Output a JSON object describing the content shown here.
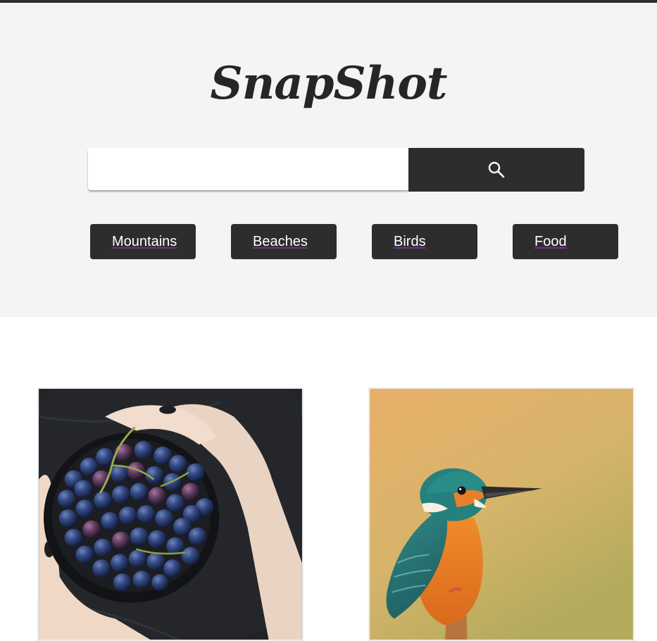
{
  "app": {
    "logo": "SnapShot"
  },
  "search": {
    "value": "",
    "placeholder": "",
    "button_icon": "search-icon"
  },
  "categories": [
    {
      "label": "Mountains"
    },
    {
      "label": "Beaches"
    },
    {
      "label": "Birds"
    },
    {
      "label": "Food"
    }
  ],
  "gallery": {
    "images": [
      {
        "alt": "grapes"
      },
      {
        "alt": "kingfisher"
      }
    ]
  },
  "colors": {
    "topbar": "#2d2d2d",
    "hero_background": "#f4f4f4",
    "button_background": "#2d2d2d",
    "button_text": "#ffffff",
    "link_underline": "#7b2c8f"
  }
}
